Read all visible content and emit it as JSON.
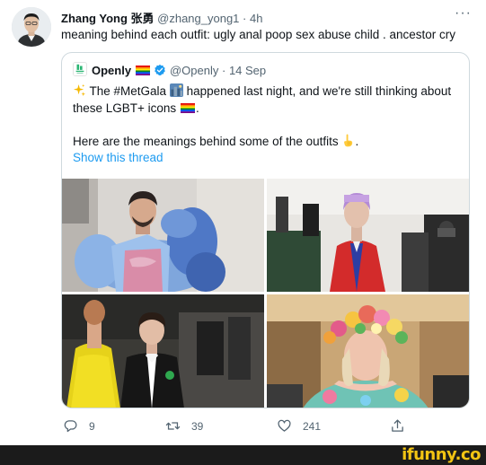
{
  "tweet": {
    "name": "Zhang Yong 张勇",
    "handle": "@zhang_yong1",
    "separator": "·",
    "time": "4h",
    "more": "···",
    "text": "meaning behind each outfit: ugly anal poop sex abuse child . ancestor cry"
  },
  "quote": {
    "name": "Openly",
    "handle": "@Openly",
    "separator": "·",
    "date": "14 Sep",
    "line1_pre": "The ",
    "hashtag": "#MetGala",
    "line1_post": " happened last night, and we're still thinking about",
    "line2": "these LGBT+ icons",
    "line2_end": ".",
    "line3": "Here are the meanings behind some of the outfits",
    "line3_end": ".",
    "show_thread": "Show this thread"
  },
  "actions": {
    "replies": "9",
    "retweets": "39",
    "likes": "241"
  },
  "watermark": {
    "text": "ifunny.co"
  },
  "icons": [
    "more-icon",
    "rainbow-flag-icon",
    "verified-icon",
    "sparkles-icon",
    "cityscape-icon",
    "point-down-icon",
    "reply-icon",
    "retweet-icon",
    "like-icon",
    "share-icon"
  ],
  "colors": {
    "link": "#1d9bf0",
    "secondary_text": "#536471",
    "border": "#cfd9de",
    "verified": "#1d9bf0",
    "watermark": "#f2c413"
  }
}
